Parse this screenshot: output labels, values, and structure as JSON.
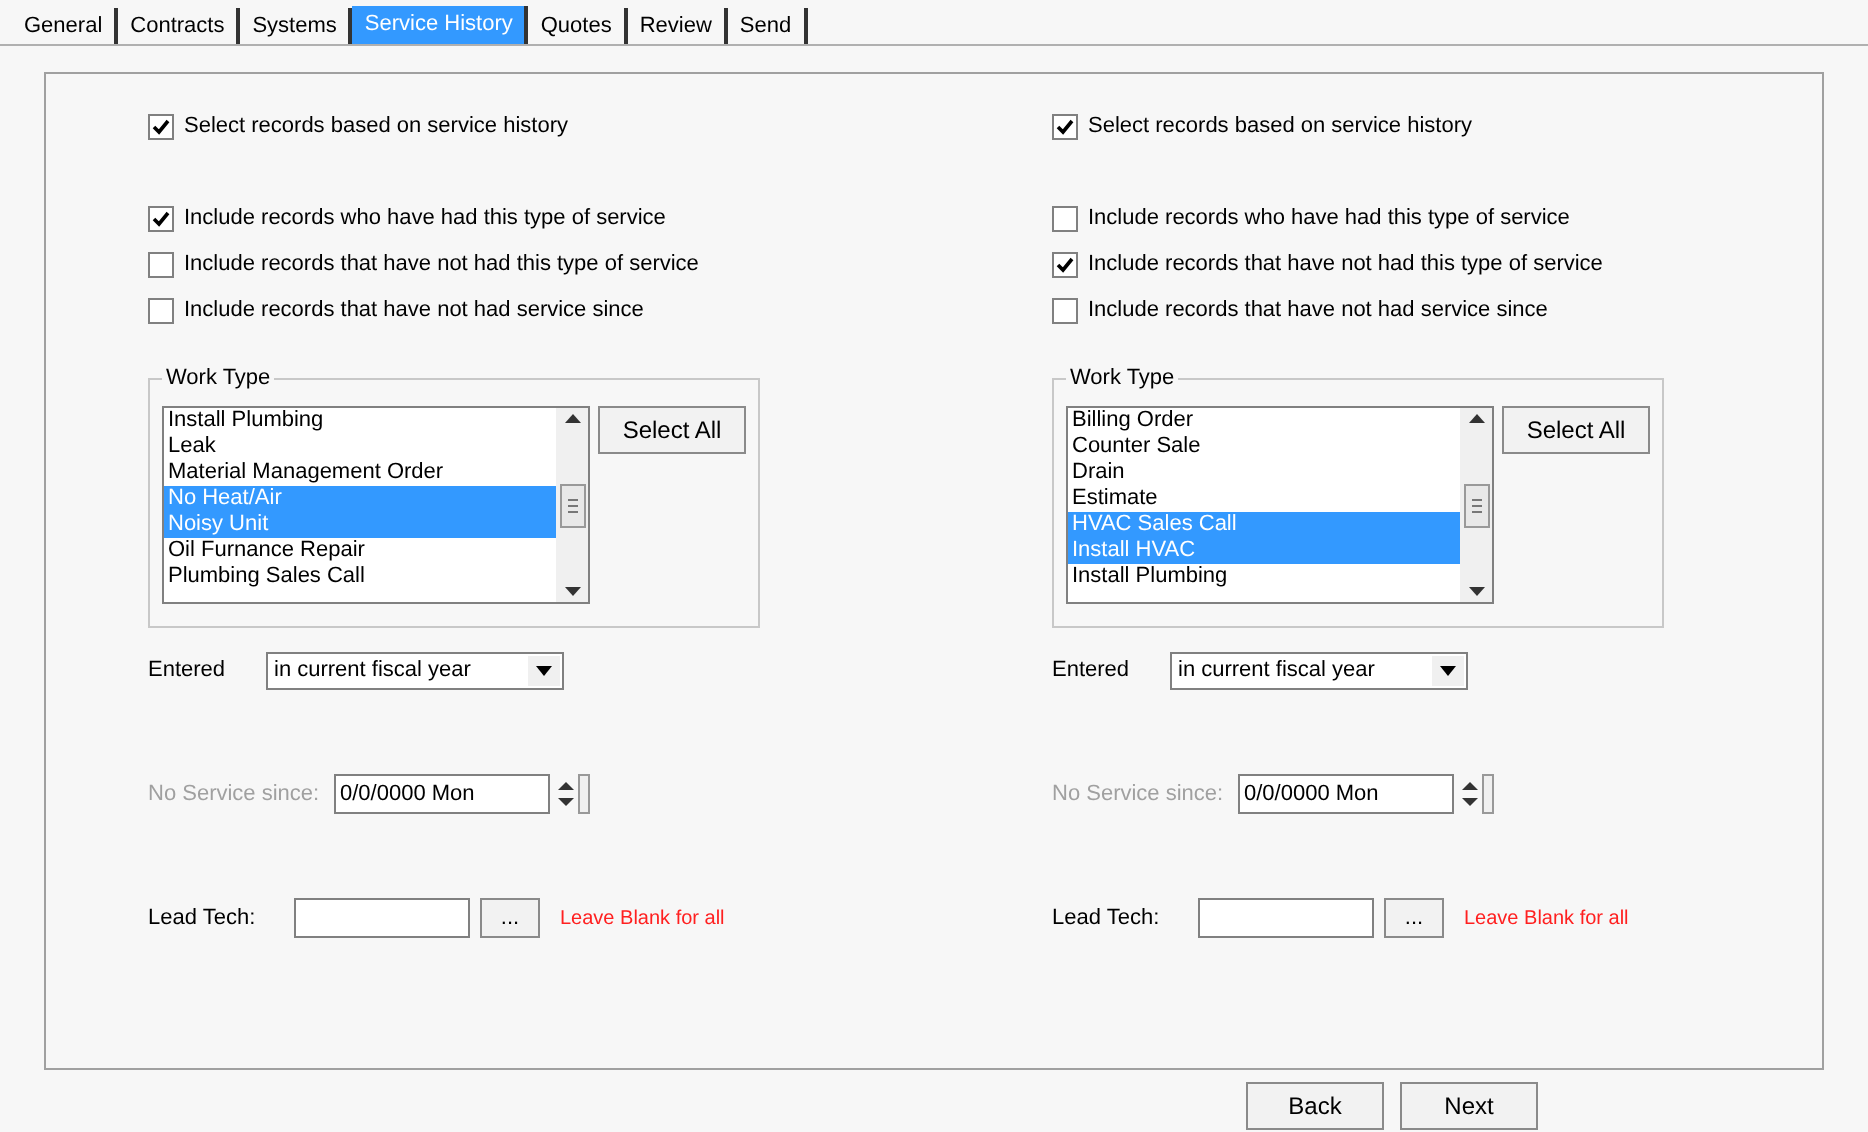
{
  "tabs": [
    {
      "label": "General",
      "selected": false
    },
    {
      "label": "Contracts",
      "selected": false
    },
    {
      "label": "Systems",
      "selected": false
    },
    {
      "label": "Service History",
      "selected": true
    },
    {
      "label": "Quotes",
      "selected": false
    },
    {
      "label": "Review",
      "selected": false
    },
    {
      "label": "Send",
      "selected": false
    }
  ],
  "panels": [
    {
      "main_option": {
        "label": "Select records based on service history",
        "checked": true
      },
      "options": [
        {
          "label": "Include records who have had this type of service",
          "checked": true
        },
        {
          "label": "Include records that have not had this type of service",
          "checked": false
        },
        {
          "label": "Include records that have not had service since",
          "checked": false
        }
      ],
      "work_type": {
        "title": "Work Type",
        "items": [
          {
            "label": "Install Plumbing",
            "selected": false
          },
          {
            "label": "Leak",
            "selected": false
          },
          {
            "label": "Material Management Order",
            "selected": false
          },
          {
            "label": "No Heat/Air",
            "selected": true
          },
          {
            "label": "Noisy Unit",
            "selected": true
          },
          {
            "label": "Oil Furnance Repair",
            "selected": false
          },
          {
            "label": "Plumbing Sales Call",
            "selected": false
          }
        ],
        "button": "Select All"
      },
      "entered": {
        "label": "Entered",
        "value": "in current fiscal year"
      },
      "no_service": {
        "label": "No Service since:",
        "value": "0/0/0000 Mon",
        "disabled": true
      },
      "lead_tech": {
        "label": "Lead Tech:",
        "button": "...",
        "hint": "Leave Blank for all"
      }
    },
    {
      "main_option": {
        "label": "Select records based on service history",
        "checked": true
      },
      "options": [
        {
          "label": "Include records who have had this type of service",
          "checked": false
        },
        {
          "label": "Include records that have not had this type of service",
          "checked": true
        },
        {
          "label": "Include records that have not had service since",
          "checked": false
        }
      ],
      "work_type": {
        "title": "Work Type",
        "items": [
          {
            "label": "Billing Order",
            "selected": false
          },
          {
            "label": "Counter Sale",
            "selected": false
          },
          {
            "label": "Drain",
            "selected": false
          },
          {
            "label": "Estimate",
            "selected": false
          },
          {
            "label": "HVAC Sales Call",
            "selected": true
          },
          {
            "label": "Install HVAC",
            "selected": true
          },
          {
            "label": "Install Plumbing",
            "selected": false
          }
        ],
        "button": "Select All"
      },
      "entered": {
        "label": "Entered",
        "value": "in current fiscal year"
      },
      "no_service": {
        "label": "No Service since:",
        "value": "0/0/0000 Mon",
        "disabled": true
      },
      "lead_tech": {
        "label": "Lead Tech:",
        "button": "...",
        "hint": "Leave Blank for all"
      }
    }
  ],
  "buttons": [
    "Back",
    "Next"
  ]
}
